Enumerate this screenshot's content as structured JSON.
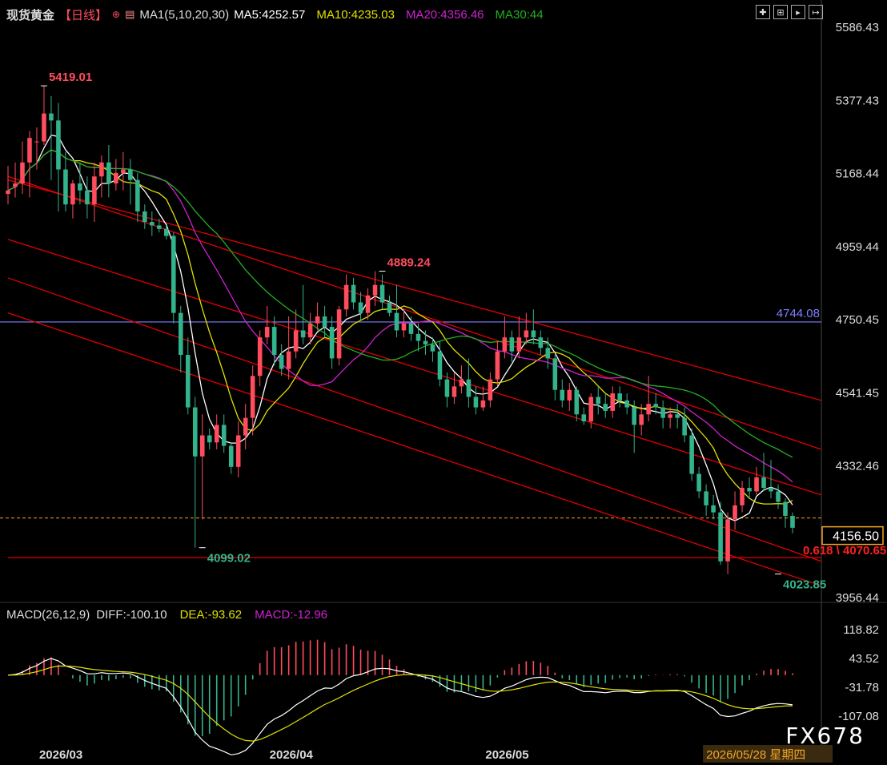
{
  "header": {
    "symbol": "现货黄金",
    "period": "【日线】",
    "ma_group": "MA1(5,10,20,30)",
    "ma5": "MA5:4252.57",
    "ma10": "MA10:4235.03",
    "ma20": "MA20:4356.46",
    "ma30": "MA30:44"
  },
  "macd_header": {
    "params": "MACD(26,12,9)",
    "diff": "DIFF:-100.10",
    "dea": "DEA:-93.62",
    "macd": "MACD:-12.96"
  },
  "watermark": "FX678",
  "colors": {
    "up": "#ff4d5e",
    "down": "#33b38c",
    "ma5": "#ffffff",
    "ma10": "#e0e000",
    "ma20": "#d020d0",
    "ma30": "#20b020",
    "channel": "#e00000",
    "hline": "#7f7fff",
    "price": "#f5a623"
  },
  "chart_data": [
    {
      "type": "candlestick",
      "title": "现货黄金【日线】",
      "y_ticks": [
        "5586.43",
        "5377.43",
        "5168.44",
        "4959.44",
        "4750.45",
        "4541.45",
        "4332.46",
        "3956.44"
      ],
      "ylim": [
        3956.44,
        5586.43
      ],
      "x_ticks": [
        {
          "label": "2026/03",
          "index": 5
        },
        {
          "label": "2026/04",
          "index": 37
        },
        {
          "label": "2026/05",
          "index": 67
        },
        {
          "label": "2026/05/28 星期四",
          "index": 97
        }
      ],
      "current_price": "4156.50",
      "reference_line": "4744.08",
      "annotations": [
        {
          "text": "5419.01",
          "index": 5,
          "value": 5419.01,
          "color": "up"
        },
        {
          "text": "4099.02",
          "index": 27,
          "value": 4099.02,
          "color": "down"
        },
        {
          "text": "4889.24",
          "index": 52,
          "value": 4889.24,
          "color": "up"
        },
        {
          "text": "4023.85",
          "index": 107,
          "value": 4023.85,
          "color": "down"
        },
        {
          "text": "0.618 \\ 4070.65",
          "index": 112,
          "value": 4070.65,
          "color": "channel"
        }
      ],
      "candles": [
        [
          5110,
          5120,
          5190,
          5080
        ],
        [
          5130,
          5140,
          5200,
          5100
        ],
        [
          5140,
          5200,
          5260,
          5110
        ],
        [
          5200,
          5270,
          5290,
          5100
        ],
        [
          5260,
          5260,
          5300,
          5180
        ],
        [
          5260,
          5340,
          5419,
          5250
        ],
        [
          5340,
          5320,
          5390,
          5150
        ],
        [
          5320,
          5180,
          5370,
          5060
        ],
        [
          5180,
          5080,
          5230,
          5060
        ],
        [
          5080,
          5140,
          5150,
          5040
        ],
        [
          5140,
          5120,
          5200,
          5080
        ],
        [
          5120,
          5080,
          5160,
          5040
        ],
        [
          5080,
          5160,
          5200,
          5030
        ],
        [
          5160,
          5200,
          5220,
          5100
        ],
        [
          5200,
          5140,
          5250,
          5100
        ],
        [
          5140,
          5170,
          5210,
          5120
        ],
        [
          5170,
          5180,
          5230,
          5120
        ],
        [
          5180,
          5150,
          5210,
          5080
        ],
        [
          5150,
          5060,
          5170,
          5030
        ],
        [
          5060,
          5030,
          5080,
          5010
        ],
        [
          5030,
          5020,
          5060,
          4990
        ],
        [
          5020,
          5010,
          5040,
          5000
        ],
        [
          5010,
          4990,
          5020,
          4980
        ],
        [
          4990,
          4770,
          5000,
          4740
        ],
        [
          4770,
          4650,
          4790,
          4600
        ],
        [
          4650,
          4500,
          4700,
          4480
        ],
        [
          4500,
          4360,
          4530,
          4099
        ],
        [
          4360,
          4420,
          4480,
          4180
        ],
        [
          4420,
          4400,
          4440,
          4380
        ],
        [
          4400,
          4450,
          4480,
          4380
        ],
        [
          4450,
          4390,
          4480,
          4370
        ],
        [
          4390,
          4330,
          4400,
          4310
        ],
        [
          4330,
          4420,
          4460,
          4300
        ],
        [
          4420,
          4470,
          4510,
          4380
        ],
        [
          4470,
          4590,
          4620,
          4420
        ],
        [
          4590,
          4700,
          4720,
          4560
        ],
        [
          4700,
          4730,
          4790,
          4680
        ],
        [
          4730,
          4650,
          4760,
          4620
        ],
        [
          4650,
          4610,
          4680,
          4590
        ],
        [
          4610,
          4660,
          4760,
          4580
        ],
        [
          4660,
          4720,
          4780,
          4640
        ],
        [
          4720,
          4700,
          4850,
          4680
        ],
        [
          4700,
          4740,
          4770,
          4680
        ],
        [
          4740,
          4760,
          4800,
          4720
        ],
        [
          4760,
          4730,
          4790,
          4700
        ],
        [
          4730,
          4640,
          4760,
          4610
        ],
        [
          4640,
          4780,
          4790,
          4620
        ],
        [
          4780,
          4850,
          4880,
          4760
        ],
        [
          4850,
          4800,
          4870,
          4780
        ],
        [
          4800,
          4770,
          4830,
          4750
        ],
        [
          4770,
          4820,
          4840,
          4750
        ],
        [
          4820,
          4850,
          4889,
          4790
        ],
        [
          4850,
          4800,
          4880,
          4780
        ],
        [
          4800,
          4770,
          4820,
          4760
        ],
        [
          4770,
          4720,
          4850,
          4700
        ],
        [
          4720,
          4740,
          4780,
          4700
        ],
        [
          4740,
          4710,
          4760,
          4690
        ],
        [
          4710,
          4690,
          4740,
          4660
        ],
        [
          4690,
          4680,
          4720,
          4650
        ],
        [
          4680,
          4660,
          4700,
          4630
        ],
        [
          4660,
          4580,
          4690,
          4560
        ],
        [
          4580,
          4530,
          4600,
          4500
        ],
        [
          4530,
          4560,
          4600,
          4510
        ],
        [
          4560,
          4580,
          4620,
          4540
        ],
        [
          4580,
          4530,
          4640,
          4500
        ],
        [
          4530,
          4500,
          4560,
          4480
        ],
        [
          4500,
          4520,
          4560,
          4490
        ],
        [
          4520,
          4580,
          4600,
          4500
        ],
        [
          4580,
          4660,
          4690,
          4560
        ],
        [
          4660,
          4700,
          4760,
          4640
        ],
        [
          4700,
          4660,
          4720,
          4630
        ],
        [
          4660,
          4700,
          4760,
          4640
        ],
        [
          4700,
          4720,
          4770,
          4680
        ],
        [
          4720,
          4700,
          4780,
          4680
        ],
        [
          4700,
          4670,
          4720,
          4650
        ],
        [
          4670,
          4640,
          4700,
          4610
        ],
        [
          4640,
          4550,
          4650,
          4520
        ],
        [
          4550,
          4520,
          4580,
          4500
        ],
        [
          4520,
          4550,
          4570,
          4490
        ],
        [
          4550,
          4480,
          4560,
          4460
        ],
        [
          4480,
          4460,
          4500,
          4450
        ],
        [
          4460,
          4530,
          4540,
          4440
        ],
        [
          4530,
          4510,
          4560,
          4480
        ],
        [
          4510,
          4490,
          4540,
          4470
        ],
        [
          4490,
          4540,
          4560,
          4470
        ],
        [
          4540,
          4520,
          4560,
          4500
        ],
        [
          4520,
          4500,
          4540,
          4480
        ],
        [
          4500,
          4450,
          4520,
          4370
        ],
        [
          4450,
          4480,
          4510,
          4420
        ],
        [
          4480,
          4510,
          4590,
          4460
        ],
        [
          4510,
          4500,
          4540,
          4480
        ],
        [
          4500,
          4470,
          4520,
          4440
        ],
        [
          4470,
          4480,
          4500,
          4440
        ],
        [
          4480,
          4470,
          4510,
          4440
        ],
        [
          4470,
          4420,
          4500,
          4400
        ],
        [
          4420,
          4310,
          4440,
          4290
        ],
        [
          4310,
          4260,
          4330,
          4240
        ],
        [
          4260,
          4220,
          4280,
          4190
        ],
        [
          4220,
          4200,
          4250,
          4180
        ],
        [
          4200,
          4060,
          4230,
          4050
        ],
        [
          4060,
          4180,
          4200,
          4023
        ],
        [
          4180,
          4220,
          4260,
          4150
        ],
        [
          4220,
          4270,
          4290,
          4200
        ],
        [
          4270,
          4260,
          4300,
          4240
        ],
        [
          4260,
          4300,
          4330,
          4250
        ],
        [
          4300,
          4270,
          4370,
          4260
        ],
        [
          4270,
          4260,
          4350,
          4240
        ],
        [
          4260,
          4230,
          4280,
          4210
        ],
        [
          4230,
          4190,
          4240,
          4156
        ],
        [
          4190,
          4156,
          4200,
          4140
        ]
      ]
    },
    {
      "type": "macd",
      "title": "MACD(26,12,9)",
      "y_ticks": [
        "118.82",
        "43.52",
        "-31.78",
        "-107.08"
      ],
      "ylim": [
        -107.08,
        118.82
      ]
    }
  ]
}
